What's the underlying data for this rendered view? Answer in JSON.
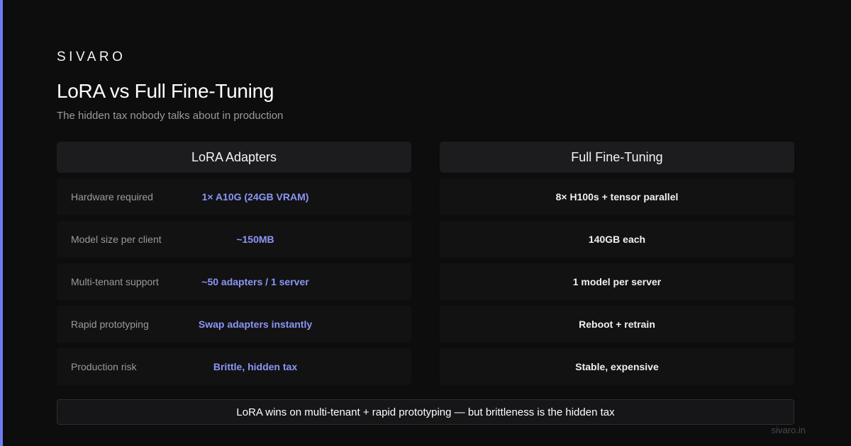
{
  "brand": "SIVARO",
  "title": "LoRA vs Full Fine-Tuning",
  "subtitle": "The hidden tax nobody talks about in production",
  "columns": {
    "left": "LoRA Adapters",
    "right": "Full Fine-Tuning"
  },
  "rows": [
    {
      "label": "Hardware required",
      "lora": "1× A10G (24GB VRAM)",
      "full": "8× H100s + tensor parallel"
    },
    {
      "label": "Model size per client",
      "lora": "~150MB",
      "full": "140GB each"
    },
    {
      "label": "Multi-tenant support",
      "lora": "~50 adapters / 1 server",
      "full": "1 model per server"
    },
    {
      "label": "Rapid prototyping",
      "lora": "Swap adapters instantly",
      "full": "Reboot + retrain"
    },
    {
      "label": "Production risk",
      "lora": "Brittle, hidden tax",
      "full": "Stable, expensive"
    }
  ],
  "summary": "LoRA wins on multi-tenant + rapid prototyping — but brittleness is the hidden tax",
  "footer_url": "sivaro.in",
  "colors": {
    "accent": "#6e7cf0",
    "lora_value": "#8b96f5",
    "background": "#0d0d0d"
  }
}
